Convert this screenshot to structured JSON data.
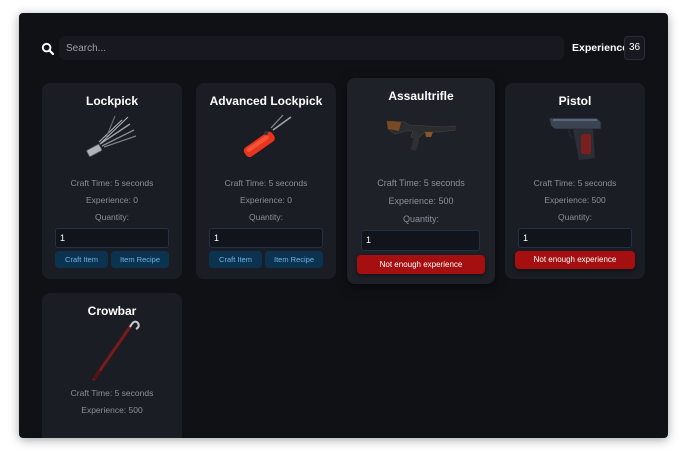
{
  "search": {
    "placeholder": "Search..."
  },
  "header": {
    "experience_label": "Experience:",
    "experience_value": "36"
  },
  "labels": {
    "quantity": "Quantity:",
    "craft_item": "Craft Item",
    "item_recipe": "Item Recipe",
    "not_enough": "Not enough experience"
  },
  "items": [
    {
      "title": "Lockpick",
      "craft_time": "Craft Time: 5 seconds",
      "experience": "Experience: 0",
      "quantity": "1",
      "icon": "lockpick-icon"
    },
    {
      "title": "Advanced Lockpick",
      "craft_time": "Craft Time: 5 seconds",
      "experience": "Experience: 0",
      "quantity": "1",
      "icon": "advanced-lockpick-icon"
    },
    {
      "title": "Assaultrifle",
      "craft_time": "Craft Time: 5 seconds",
      "experience": "Experience: 500",
      "quantity": "1",
      "icon": "assault-rifle-icon"
    },
    {
      "title": "Pistol",
      "craft_time": "Craft Time: 5 seconds",
      "experience": "Experience: 500",
      "quantity": "1",
      "icon": "pistol-icon"
    },
    {
      "title": "Crowbar",
      "craft_time": "Craft Time: 5 seconds",
      "experience": "Experience: 500",
      "icon": "crowbar-icon"
    }
  ],
  "colors": {
    "background": "#0f1115",
    "card": "#1a1d23",
    "blue_button": "#0b3350",
    "blue_text": "#6ab4e6",
    "red_button": "#a50f10"
  }
}
